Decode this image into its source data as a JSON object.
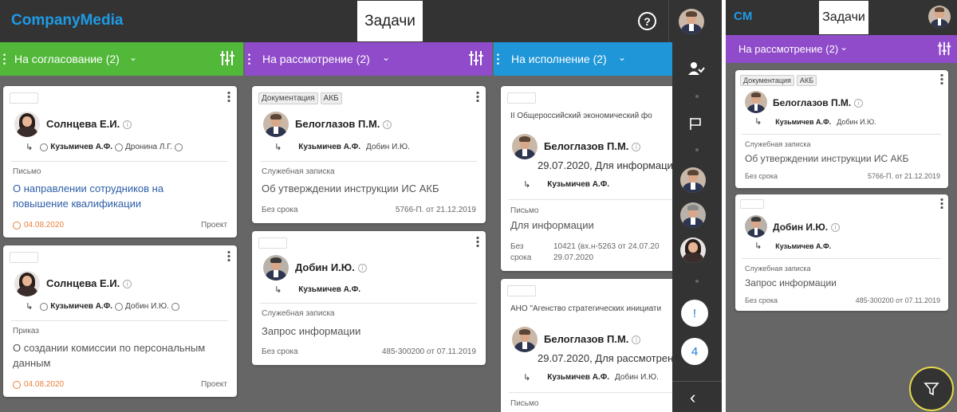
{
  "app": {
    "brand": "CompanyMedia",
    "brand_short": "CM",
    "tasks_label": "Задачи",
    "help_icon": "help-icon"
  },
  "colors": {
    "topbar": "#333333",
    "brand": "#1e9be6",
    "approval": "#52b83a",
    "review": "#8f4bc9",
    "execution": "#1e96d8",
    "board_bg": "#666666",
    "date_orange": "#e8803a"
  },
  "columns": [
    {
      "title": "На согласование (2)",
      "cards": [
        {
          "author": "Солнцева Е.И.",
          "route_to": "Кузьмичев А.Ф.",
          "route_cc": "Дронина Л.Г.",
          "doctype": "Письмо",
          "subject_1": "О направлении сотрудников на",
          "subject_2": "повышение квалификации",
          "date": "04.08.2020",
          "status": "Проект"
        },
        {
          "author": "Солнцева Е.И.",
          "route_to": "Кузьмичев А.Ф.",
          "route_cc": "Добин И.Ю.",
          "doctype": "Приказ",
          "subject_1": "О создании комиссии по персональным",
          "subject_2": "данным",
          "date": "04.08.2020",
          "status": "Проект"
        }
      ]
    },
    {
      "title": "На рассмотрение (2)",
      "cards": [
        {
          "tags": [
            "Документация",
            "АКБ"
          ],
          "author": "Белоглазов П.М.",
          "route_to": "Кузьмичев А.Ф.",
          "route_cc": "Добин И.Ю.",
          "doctype": "Служебная записка",
          "subject": "Об утверждении инструкции ИС АКБ",
          "deadline": "Без срока",
          "reg": "5766-П. от 21.12.2019"
        },
        {
          "author": "Добин И.Ю.",
          "route_to": "Кузьмичев А.Ф.",
          "doctype": "Служебная записка",
          "subject": "Запрос информации",
          "deadline": "Без срока",
          "reg": "485-300200 от 07.11.2019"
        }
      ]
    },
    {
      "title": "На исполнение (2)",
      "cards": [
        {
          "org": "II Общероссийский экономический фо",
          "author": "Белоглазов П.М.",
          "resolution": "29.07.2020, Для информаци",
          "route_to": "Кузьмичев А.Ф.",
          "doctype": "Письмо",
          "subject": "Для информации",
          "deadline_1": "Без",
          "deadline_2": "срока",
          "reg_1": "10421 (вх.н-5263 от 24.07.20",
          "reg_2": "29.07.2020"
        },
        {
          "org": "АНО \"Агенство стратегических инициати",
          "author": "Белоглазов П.М.",
          "resolution": "29.07.2020, Для рассмотрен",
          "route_to": "Кузьмичев А.Ф.",
          "route_cc": "Добин И.Ю.",
          "doctype": "Письмо"
        }
      ]
    }
  ],
  "rail": {
    "counter_alert": "!",
    "counter_count": "4",
    "collapse_icon": "chevron-left-icon"
  }
}
